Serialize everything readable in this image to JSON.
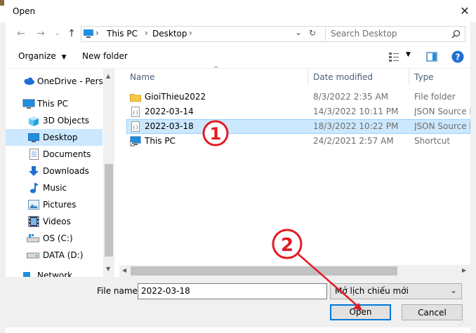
{
  "window": {
    "title": "Open"
  },
  "address": {
    "segments": [
      "This PC",
      "Desktop"
    ]
  },
  "search": {
    "placeholder": "Search Desktop"
  },
  "toolbar": {
    "organize": "Organize",
    "new_folder": "New folder"
  },
  "nav": {
    "items": [
      {
        "label": "OneDrive - Person",
        "icon": "cloud-icon"
      },
      {
        "label": "This PC",
        "icon": "computer-icon"
      },
      {
        "label": "3D Objects",
        "icon": "cube-icon"
      },
      {
        "label": "Desktop",
        "icon": "desktop-icon",
        "selected": true
      },
      {
        "label": "Documents",
        "icon": "document-icon"
      },
      {
        "label": "Downloads",
        "icon": "download-icon"
      },
      {
        "label": "Music",
        "icon": "music-icon"
      },
      {
        "label": "Pictures",
        "icon": "picture-icon"
      },
      {
        "label": "Videos",
        "icon": "video-icon"
      },
      {
        "label": "OS (C:)",
        "icon": "drive-icon"
      },
      {
        "label": "DATA (D:)",
        "icon": "drive-icon"
      },
      {
        "label": "Network",
        "icon": "network-icon"
      }
    ]
  },
  "columns": {
    "name": "Name",
    "date": "Date modified",
    "type": "Type"
  },
  "files": [
    {
      "name": "GioiThieu2022",
      "date": "8/3/2022 2:35 AM",
      "type": "File folder",
      "icon": "folder-icon"
    },
    {
      "name": "2022-03-14",
      "date": "14/3/2022 10:11 PM",
      "type": "JSON Source File",
      "icon": "json-file-icon"
    },
    {
      "name": "2022-03-18",
      "date": "18/3/2022 10:22 PM",
      "type": "JSON Source File",
      "icon": "json-file-icon",
      "selected": true
    },
    {
      "name": "This PC",
      "date": "24/2/2021 2:57 AM",
      "type": "Shortcut",
      "icon": "shortcut-icon"
    }
  ],
  "bottom": {
    "file_name_label": "File name:",
    "file_name_value": "2022-03-18",
    "filter_value": "Mở lịch chiếu mới",
    "open_label": "Open",
    "cancel_label": "Cancel"
  },
  "annotations": {
    "one": "1",
    "two": "2"
  },
  "colors": {
    "selection": "#cce8ff",
    "accent": "#0078d7",
    "annotation": "#e21b23"
  }
}
